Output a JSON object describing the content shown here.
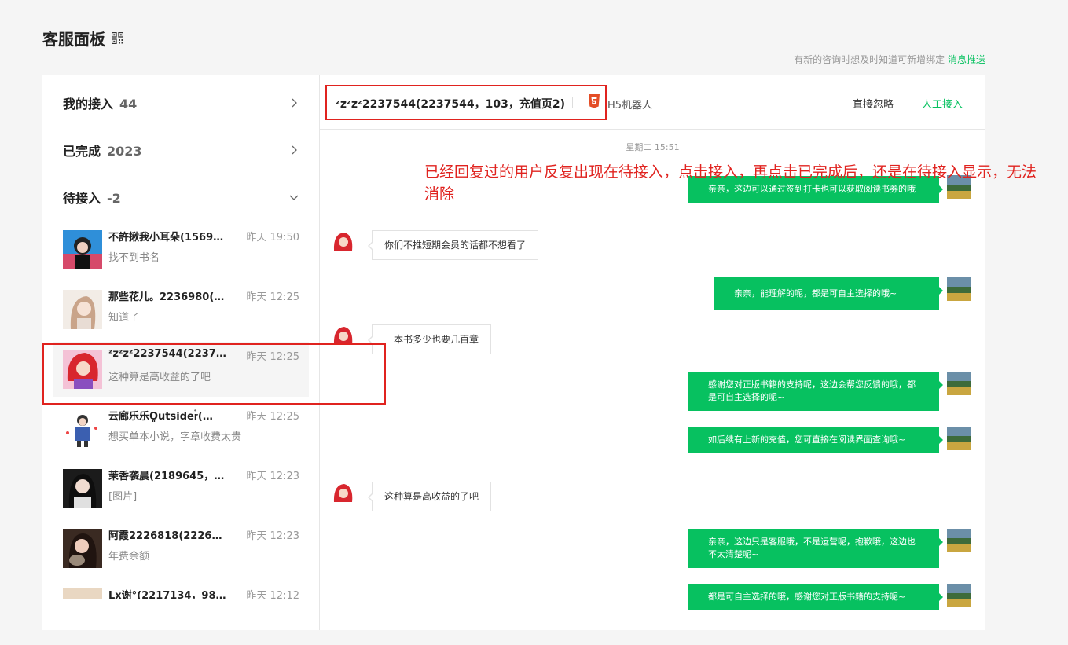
{
  "page": {
    "title": "客服面板",
    "notice_text": "有新的咨询时想及时知道可新增绑定",
    "notice_link": "消息推送"
  },
  "sections": [
    {
      "label": "我的接入",
      "count": "44"
    },
    {
      "label": "已完成",
      "count": "2023"
    },
    {
      "label": "待接入",
      "count": "-2"
    }
  ],
  "conversations": [
    {
      "name": "不許揪我小耳朵(1569…",
      "time": "昨天 19:50",
      "last": "找不到书名"
    },
    {
      "name": "那些花儿。2236980(…",
      "time": "昨天 12:25",
      "last": "知道了"
    },
    {
      "name": "ᶻzᶻzᶻ2237544(223754…",
      "time": "昨天 12:25",
      "last": "这种算是高收益的了吧"
    },
    {
      "name": "云廊乐乐O͈utsider͛(…",
      "time": "昨天 12:25",
      "last": "想买单本小说，字章收费太贵"
    },
    {
      "name": "茉香袭晨(2189645，…",
      "time": "昨天 12:23",
      "last": "[图片]"
    },
    {
      "name": "阿霞2226818(222681…",
      "time": "昨天 12:23",
      "last": "年费余额"
    },
    {
      "name": "Lx谢°(2217134，98…",
      "time": "昨天 12:12",
      "last": ""
    }
  ],
  "chat": {
    "title": "ᶻzᶻzᶻ2237544(2237544，103，充值页2)",
    "channel": "H5机器人",
    "ignore_label": "直接忽略",
    "accept_label": "人工接入",
    "day_label": "星期二 15:51",
    "messages": [
      {
        "dir": "out",
        "text": "亲亲，这边可以通过签到打卡也可以获取阅读书券的哦"
      },
      {
        "dir": "in",
        "text": "你们不推短期会员的话都不想看了"
      },
      {
        "dir": "out",
        "text": "亲亲，能理解的呢，都是可自主选择的哦~"
      },
      {
        "dir": "in",
        "text": "一本书多少也要几百章"
      },
      {
        "dir": "out",
        "text": "感谢您对正版书籍的支持呢，这边会帮您反馈的哦，都是可自主选择的呢~"
      },
      {
        "dir": "out",
        "text": "如后续有上新的充值，您可直接在阅读界面查询哦~"
      },
      {
        "dir": "in",
        "text": "这种算是高收益的了吧"
      },
      {
        "dir": "out",
        "text": "亲亲，这边只是客服哦，不是运营呢，抱歉哦，这边也不太清楚呢~"
      },
      {
        "dir": "out",
        "text": "都是可自主选择的哦，感谢您对正版书籍的支持呢~"
      }
    ]
  },
  "annotation": "已经回复过的用户反复出现在待接入，点击接入，再点击已完成后，还是在待接入显示，无法消除",
  "colors": {
    "accent": "#07c160",
    "annotation": "#e0231f"
  }
}
